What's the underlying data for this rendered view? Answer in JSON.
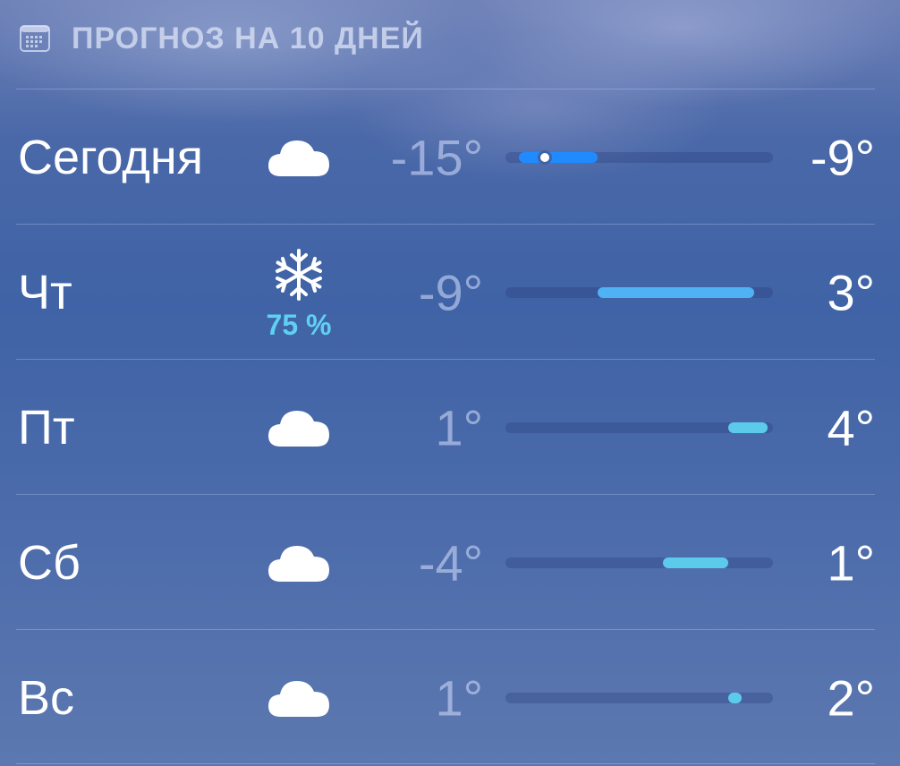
{
  "header": {
    "icon": "calendar-icon",
    "title": "ПРОГНОЗ НА 10 ДНЕЙ"
  },
  "forecast": [
    {
      "day": "Сегодня",
      "icon": "cloud-icon",
      "precip": "",
      "low": "-15°",
      "high": "-9°",
      "low_value": -15,
      "high_value": -9,
      "current_value": -13
    },
    {
      "day": "Чт",
      "icon": "snowflake-icon",
      "precip": "75 %",
      "low": "-9°",
      "high": "3°",
      "low_value": -9,
      "high_value": 3
    },
    {
      "day": "Пт",
      "icon": "cloud-icon",
      "precip": "",
      "low": "1°",
      "high": "4°",
      "low_value": 1,
      "high_value": 4
    },
    {
      "day": "Сб",
      "icon": "cloud-icon",
      "precip": "",
      "low": "-4°",
      "high": "1°",
      "low_value": -4,
      "high_value": 1
    },
    {
      "day": "Вс",
      "icon": "cloud-icon",
      "precip": "",
      "low": "1°",
      "high": "2°",
      "low_value": 1,
      "high_value": 2
    }
  ],
  "colors": {
    "cold": "#1f8bff",
    "cool": "#4fb2f5",
    "mild": "#5ccbeb",
    "precip": "#5fd0f3"
  }
}
